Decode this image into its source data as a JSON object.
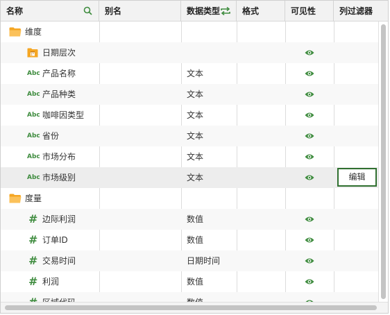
{
  "columns": {
    "name": "名称",
    "alias": "别名",
    "datatype": "数据类型",
    "format": "格式",
    "visibility": "可见性",
    "filter": "列过滤器"
  },
  "header_icons": {
    "name": "search-icon",
    "datatype": "swap-icon"
  },
  "colors": {
    "accent": "#3f8c3f",
    "folder": "#f5a623",
    "selected_border": "#2f6f2f"
  },
  "rows": [
    {
      "kind": "folder",
      "icon": "folder-icon",
      "name": "维度",
      "type": "",
      "visible": false,
      "filter": ""
    },
    {
      "kind": "date",
      "icon": "date-hierarchy-icon",
      "name": "日期层次",
      "type": "",
      "visible": true,
      "filter": ""
    },
    {
      "kind": "text",
      "icon": "abc-icon",
      "name": "产品名称",
      "type": "文本",
      "visible": true,
      "filter": ""
    },
    {
      "kind": "text",
      "icon": "abc-icon",
      "name": "产品种类",
      "type": "文本",
      "visible": true,
      "filter": ""
    },
    {
      "kind": "text",
      "icon": "abc-icon",
      "name": "咖啡因类型",
      "type": "文本",
      "visible": true,
      "filter": ""
    },
    {
      "kind": "text",
      "icon": "abc-icon",
      "name": "省份",
      "type": "文本",
      "visible": true,
      "filter": ""
    },
    {
      "kind": "text",
      "icon": "abc-icon",
      "name": "市场分布",
      "type": "文本",
      "visible": true,
      "filter": ""
    },
    {
      "kind": "text",
      "icon": "abc-icon",
      "name": "市场级别",
      "type": "文本",
      "visible": true,
      "filter": "编辑",
      "selected": true
    },
    {
      "kind": "folder",
      "icon": "folder-icon",
      "name": "度量",
      "type": "",
      "visible": false,
      "filter": ""
    },
    {
      "kind": "number",
      "icon": "hash-icon",
      "name": "边际利润",
      "type": "数值",
      "visible": true,
      "filter": ""
    },
    {
      "kind": "number",
      "icon": "hash-icon",
      "name": "订单ID",
      "type": "数值",
      "visible": true,
      "filter": ""
    },
    {
      "kind": "number",
      "icon": "hash-icon",
      "name": "交易时间",
      "type": "日期时间",
      "visible": true,
      "filter": ""
    },
    {
      "kind": "number",
      "icon": "hash-icon",
      "name": "利润",
      "type": "数值",
      "visible": true,
      "filter": ""
    },
    {
      "kind": "number",
      "icon": "hash-icon",
      "name": "区域代码",
      "type": "数值",
      "visible": true,
      "filter": ""
    }
  ]
}
